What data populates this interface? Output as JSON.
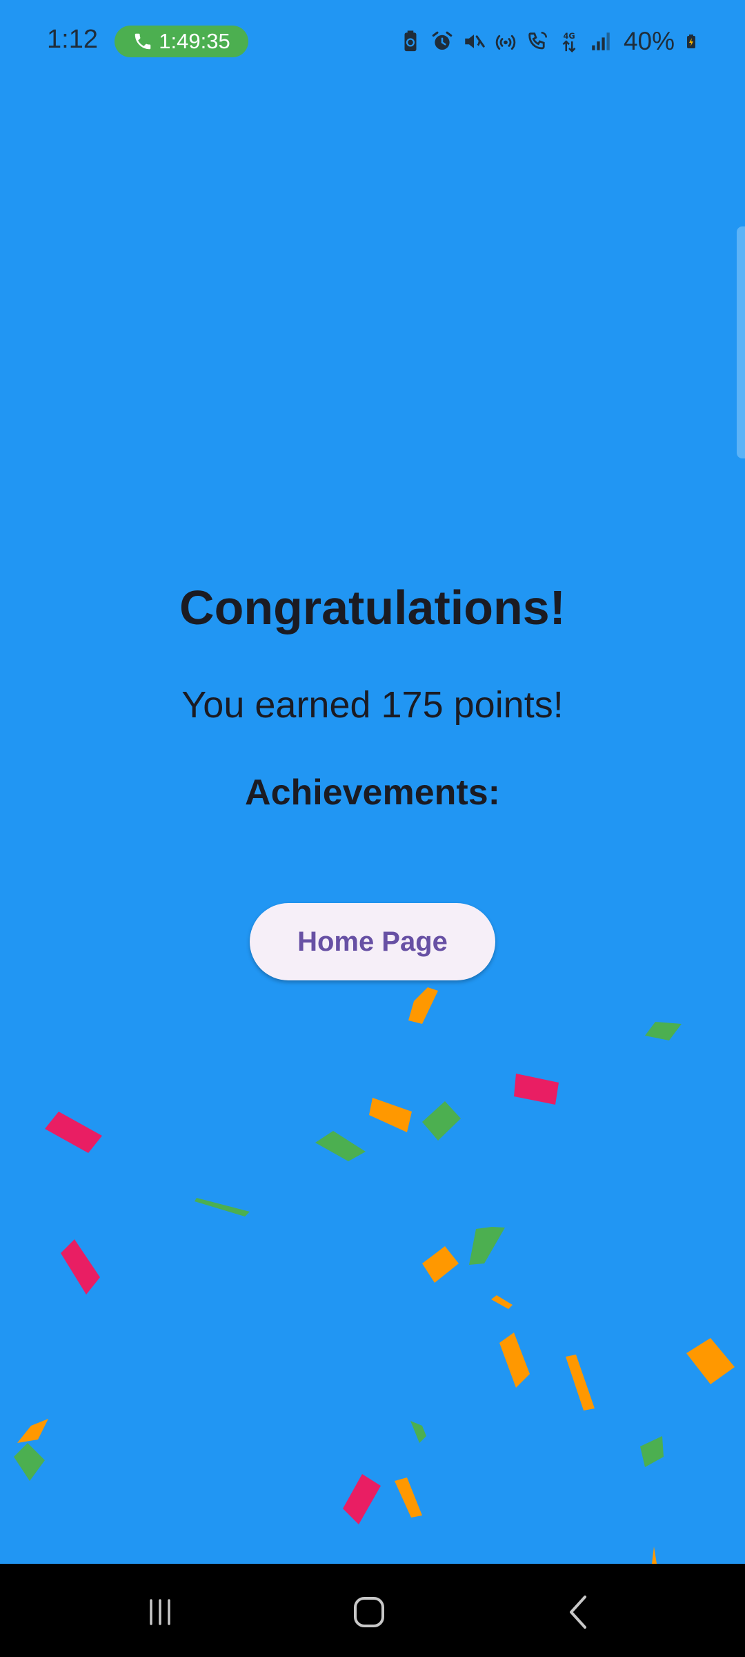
{
  "status_bar": {
    "time": "1:12",
    "call_duration": "1:49:35",
    "battery": "40%",
    "icons": [
      "battery-saver-icon",
      "alarm-icon",
      "mute-icon",
      "hotspot-icon",
      "wifi-calling-icon",
      "4g-data-icon",
      "signal-icon",
      "battery-charging-icon"
    ]
  },
  "main": {
    "title": "Congratulations!",
    "points_text": "You earned 175 points!",
    "achievements_label": "Achievements:",
    "home_button_label": "Home Page"
  },
  "colors": {
    "background": "#2196F3",
    "button_bg": "#F6EFF8",
    "button_text": "#6750A4",
    "confetti": [
      "#E91E63",
      "#FF9800",
      "#4CAF50"
    ],
    "call_chip": "#4CAF50"
  },
  "navigation": {
    "buttons": [
      "recent-apps-icon",
      "home-icon",
      "back-icon"
    ]
  }
}
